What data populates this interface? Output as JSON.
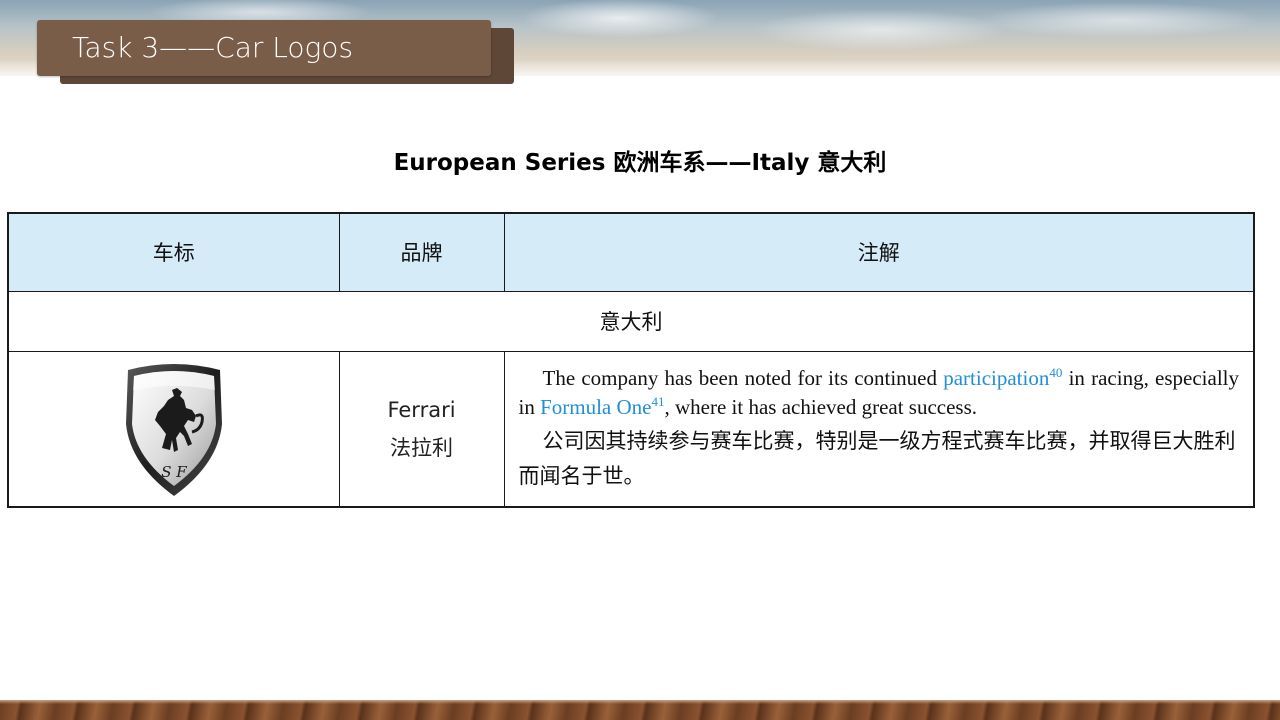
{
  "slide": {
    "title": "Task 3——Car Logos",
    "subtitle": "European Series  欧洲车系——Italy  意大利"
  },
  "table": {
    "headers": [
      "车标",
      "品牌",
      "注解"
    ],
    "group_label": "意大利",
    "row": {
      "logo_icon": "ferrari-shield-logo",
      "logo_initials": "S F",
      "brand_en": "Ferrari",
      "brand_zh": "法拉利",
      "note_en_part1": "The company has been noted for its continued ",
      "note_en_term1": "participation",
      "note_en_ref1": "40",
      "note_en_part2": " in racing, especially in ",
      "note_en_term2": "Formula One",
      "note_en_ref2": "41",
      "note_en_part3": ", where it has achieved great success.",
      "note_zh": "公司因其持续参与赛车比赛，特别是一级方程式赛车比赛，并取得巨大胜利而闻名于世。"
    }
  },
  "colors": {
    "header_bg": "#d5ebf8",
    "title_tab": "#7a5d49",
    "highlight": "#1f8fd6"
  }
}
